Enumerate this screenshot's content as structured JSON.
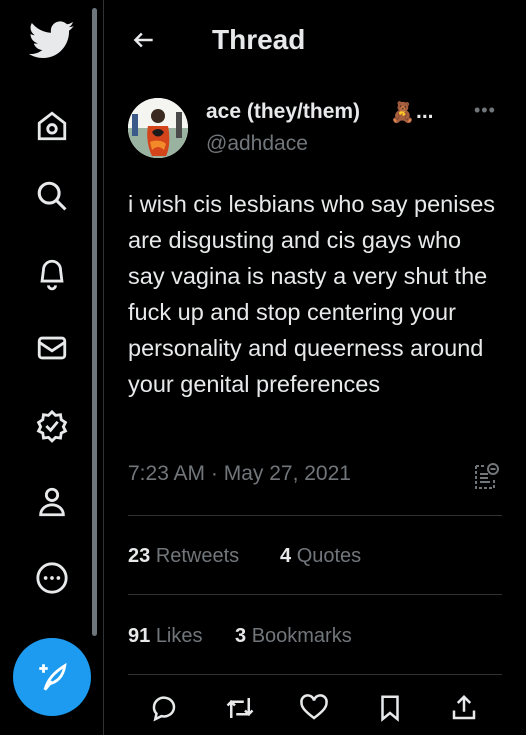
{
  "header": {
    "title": "Thread"
  },
  "tweet": {
    "author_name": "ace (they/them)",
    "author_emoji": "🧸",
    "author_ellipsis": "...",
    "handle": "@adhdace",
    "more_label": "•••",
    "text": "i wish cis lesbians who say penises are disgusting and cis gays who say vagina is nasty a very shut the fuck up and stop centering your personality and queerness around your genital preferences",
    "timestamp": "7:23 AM · May 27, 2021"
  },
  "stats": {
    "retweets_count": "23",
    "retweets_label": "Retweets",
    "quotes_count": "4",
    "quotes_label": "Quotes",
    "likes_count": "91",
    "likes_label": "Likes",
    "bookmarks_count": "3",
    "bookmarks_label": "Bookmarks"
  },
  "colors": {
    "accent": "#1d9bf0",
    "background": "#000000",
    "text": "#e7e9ea",
    "muted": "#71767b",
    "border": "#2f3336"
  }
}
